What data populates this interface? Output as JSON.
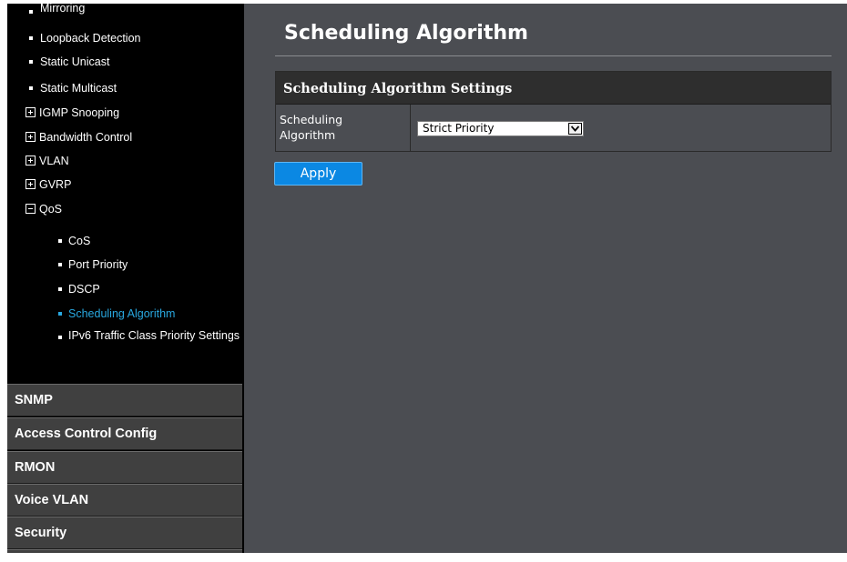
{
  "sidebar": {
    "tree": [
      {
        "type": "leaf",
        "label": "Mirroring"
      },
      {
        "type": "leaf",
        "label": "Loopback Detection"
      },
      {
        "type": "leaf",
        "label": "Static Unicast"
      },
      {
        "type": "leaf",
        "label": "Static Multicast"
      },
      {
        "type": "folder",
        "expanded": false,
        "label": "IGMP Snooping"
      },
      {
        "type": "folder",
        "expanded": false,
        "label": "Bandwidth Control"
      },
      {
        "type": "folder",
        "expanded": false,
        "label": "VLAN"
      },
      {
        "type": "folder",
        "expanded": false,
        "label": "GVRP"
      },
      {
        "type": "folder",
        "expanded": true,
        "label": "QoS"
      },
      {
        "type": "subleaf",
        "label": "CoS"
      },
      {
        "type": "subleaf",
        "label": "Port Priority"
      },
      {
        "type": "subleaf",
        "label": "DSCP"
      },
      {
        "type": "subleaf",
        "label": "Scheduling Algorithm",
        "active": true
      },
      {
        "type": "subleaf",
        "label": "IPv6 Traffic Class Priority Settings"
      }
    ],
    "menus": [
      "SNMP",
      "Access Control Config",
      "RMON",
      "Voice VLAN",
      "Security"
    ]
  },
  "main": {
    "title": "Scheduling Algorithm",
    "section_title": "Scheduling Algorithm Settings",
    "field_label": "Scheduling Algorithm",
    "selected_value": "Strict Priority",
    "apply_label": "Apply"
  },
  "colors": {
    "sidebar_bg": "#000000",
    "active_item": "#29a8e0",
    "main_bg": "#4b4d52",
    "section_header_bg": "#2e2e2e",
    "menu_button_bg": "#404040",
    "apply_button": "#0b88e3"
  }
}
